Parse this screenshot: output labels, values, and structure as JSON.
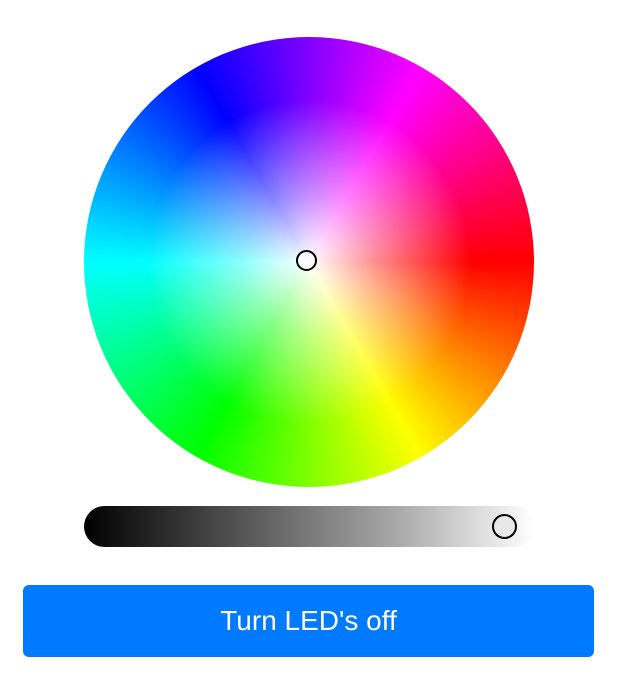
{
  "color_picker": {
    "hue_wheel_icon": "color-wheel",
    "selected_color": "#ffffff",
    "brightness_level": 0.97
  },
  "colors": {
    "button_background": "#007bff",
    "button_text": "#ffffff",
    "handle_border": "#000000"
  },
  "actions": {
    "toggle_led_label": "Turn LED's off"
  }
}
